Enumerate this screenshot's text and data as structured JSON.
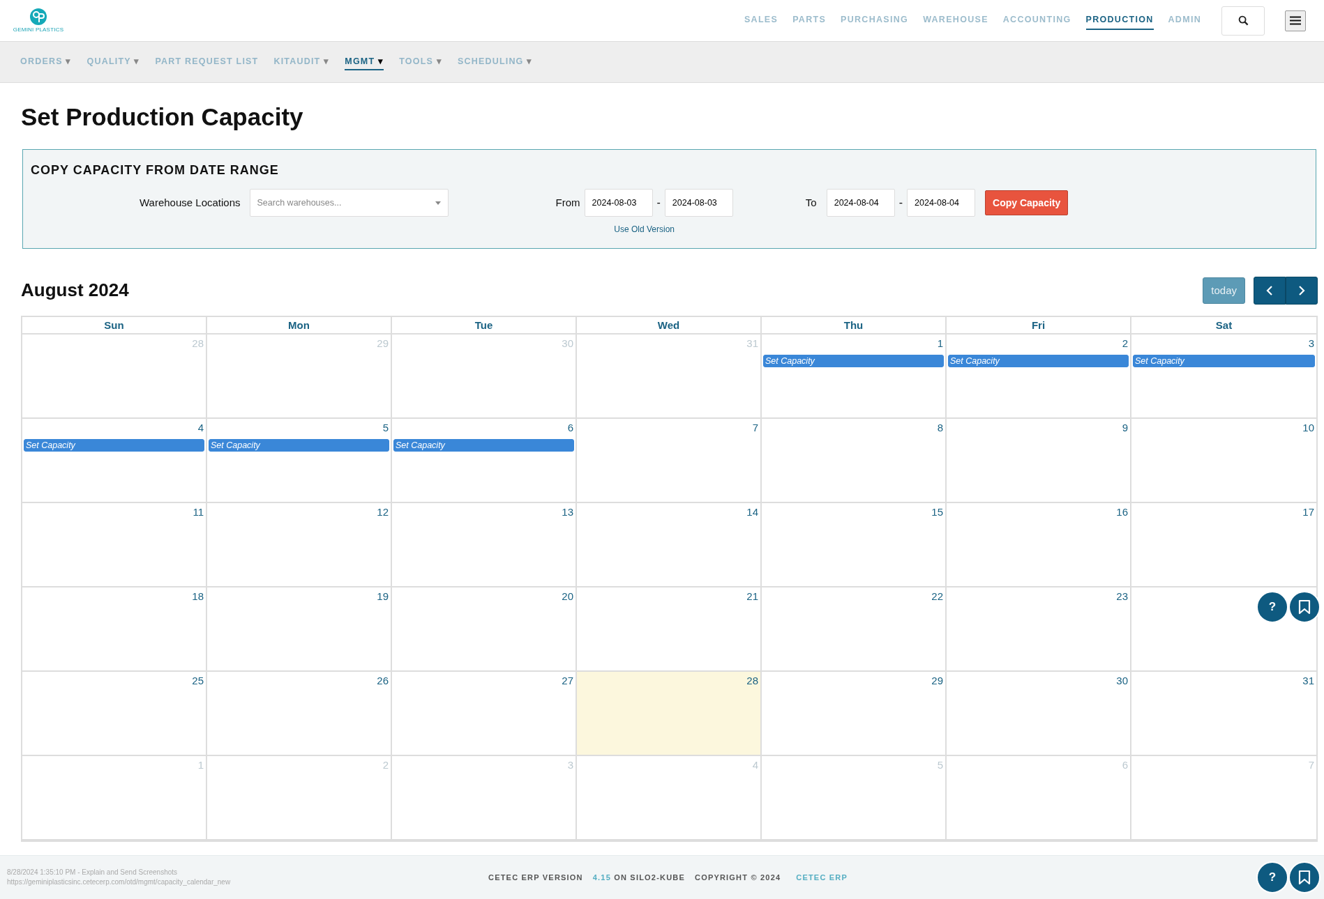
{
  "brand": {
    "name": "GEMINI PLASTICS"
  },
  "main_nav": [
    {
      "label": "SALES",
      "selected": false
    },
    {
      "label": "PARTS",
      "selected": false
    },
    {
      "label": "PURCHASING",
      "selected": false
    },
    {
      "label": "WAREHOUSE",
      "selected": false
    },
    {
      "label": "ACCOUNTING",
      "selected": false
    },
    {
      "label": "PRODUCTION",
      "selected": true
    },
    {
      "label": "ADMIN",
      "selected": false
    }
  ],
  "sub_nav": [
    {
      "label": "ORDERS",
      "caret": "▾",
      "selected": false
    },
    {
      "label": "QUALITY",
      "caret": "▾",
      "selected": false
    },
    {
      "label": "PART REQUEST LIST",
      "selected": false
    },
    {
      "label": "KITAUDIT",
      "caret": "▾",
      "selected": false
    },
    {
      "label": "MGMT",
      "caret": "▾",
      "selected": true
    },
    {
      "label": "TOOLS",
      "caret": "▾",
      "selected": false
    },
    {
      "label": "SCHEDULING",
      "caret": "▾",
      "selected": false
    }
  ],
  "page_title": "Set Production Capacity",
  "copy_panel": {
    "title": "COPY CAPACITY FROM DATE RANGE",
    "warehouse_label": "Warehouse Locations",
    "warehouse_placeholder": "Search warehouses...",
    "from_label": "From",
    "from_start": "2024-08-03",
    "from_sep": "-",
    "from_end": "2024-08-03",
    "to_label": "To",
    "to_start": "2024-08-04",
    "to_sep": "-",
    "to_end": "2024-08-04",
    "button": "Copy Capacity",
    "link": "Use Old Version"
  },
  "calendar": {
    "title": "August 2024",
    "today_button": "today",
    "weekdays": [
      "Sun",
      "Mon",
      "Tue",
      "Wed",
      "Thu",
      "Fri",
      "Sat"
    ],
    "days": [
      {
        "day": "28",
        "outside": true,
        "today": false
      },
      {
        "day": "29",
        "outside": true,
        "today": false
      },
      {
        "day": "30",
        "outside": true,
        "today": false
      },
      {
        "day": "31",
        "outside": true,
        "today": false
      },
      {
        "day": "1",
        "outside": false,
        "today": false,
        "events": [
          "Set Capacity"
        ]
      },
      {
        "day": "2",
        "outside": false,
        "today": false,
        "events": [
          "Set Capacity"
        ]
      },
      {
        "day": "3",
        "outside": false,
        "today": false,
        "events": [
          "Set Capacity"
        ]
      },
      {
        "day": "4",
        "outside": false,
        "today": false,
        "events": [
          "Set Capacity"
        ]
      },
      {
        "day": "5",
        "outside": false,
        "today": false,
        "events": [
          "Set Capacity"
        ]
      },
      {
        "day": "6",
        "outside": false,
        "today": false,
        "events": [
          "Set Capacity"
        ]
      },
      {
        "day": "7",
        "outside": false,
        "today": false
      },
      {
        "day": "8",
        "outside": false,
        "today": false
      },
      {
        "day": "9",
        "outside": false,
        "today": false
      },
      {
        "day": "10",
        "outside": false,
        "today": false
      },
      {
        "day": "11",
        "outside": false,
        "today": false
      },
      {
        "day": "12",
        "outside": false,
        "today": false
      },
      {
        "day": "13",
        "outside": false,
        "today": false
      },
      {
        "day": "14",
        "outside": false,
        "today": false
      },
      {
        "day": "15",
        "outside": false,
        "today": false
      },
      {
        "day": "16",
        "outside": false,
        "today": false
      },
      {
        "day": "17",
        "outside": false,
        "today": false
      },
      {
        "day": "18",
        "outside": false,
        "today": false
      },
      {
        "day": "19",
        "outside": false,
        "today": false
      },
      {
        "day": "20",
        "outside": false,
        "today": false
      },
      {
        "day": "21",
        "outside": false,
        "today": false
      },
      {
        "day": "22",
        "outside": false,
        "today": false
      },
      {
        "day": "23",
        "outside": false,
        "today": false
      },
      {
        "today": false
      },
      {
        "day": "25",
        "outside": false,
        "today": false
      },
      {
        "day": "26",
        "outside": false,
        "today": false
      },
      {
        "day": "27",
        "outside": false,
        "today": false
      },
      {
        "day": "28",
        "outside": false,
        "today": true
      },
      {
        "day": "29",
        "outside": false,
        "today": false
      },
      {
        "day": "30",
        "outside": false,
        "today": false
      },
      {
        "day": "31",
        "outside": false,
        "today": false
      },
      {
        "day": "1",
        "outside": true,
        "today": false
      },
      {
        "day": "2",
        "outside": true,
        "today": false
      },
      {
        "day": "3",
        "outside": true,
        "today": false
      },
      {
        "day": "4",
        "outside": true,
        "today": false
      },
      {
        "day": "5",
        "outside": true,
        "today": false
      },
      {
        "day": "6",
        "outside": true,
        "today": false
      },
      {
        "day": "7",
        "outside": true,
        "today": false
      }
    ]
  },
  "floating_buttons": {
    "help": "?"
  },
  "footer": {
    "screenshot_note": "8/28/2024 1:35:10 PM - Explain and Send Screenshots",
    "url": "https://geminiplasticsinc.cetecerp.com/otd/mgmt/capacity_calendar_new",
    "version_label": "CETEC ERP VERSION",
    "version": "4.15",
    "server": "ON SILO2-KUBE",
    "copyright": "COPYRIGHT © 2024",
    "company_link": "CETEC ERP",
    "help": "?"
  }
}
